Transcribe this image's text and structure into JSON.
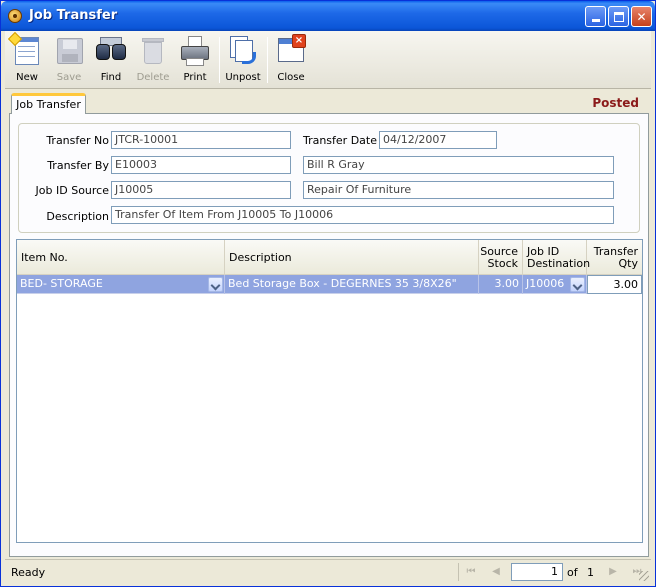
{
  "window": {
    "title": "Job Transfer"
  },
  "toolbar": {
    "new": "New",
    "save": "Save",
    "find": "Find",
    "delete": "Delete",
    "print": "Print",
    "unpost": "Unpost",
    "close": "Close"
  },
  "tab": {
    "label": "Job Transfer",
    "status": "Posted"
  },
  "form": {
    "transfer_no_label": "Transfer No",
    "transfer_no": "JTCR-10001",
    "transfer_date_label": "Transfer Date",
    "transfer_date": "04/12/2007",
    "transfer_by_label": "Transfer By",
    "transfer_by": "E10003",
    "transfer_by_name": "Bill R Gray",
    "job_id_source_label": "Job ID Source",
    "job_id_source": "J10005",
    "job_id_source_name": "Repair Of Furniture",
    "description_label": "Description",
    "description": "Transfer Of Item From J10005 To J10006"
  },
  "grid": {
    "headers": {
      "item_no": "Item No.",
      "description": "Description",
      "source_stock_1": "Source",
      "source_stock_2": "Stock",
      "job_dest_1": "Job ID",
      "job_dest_2": "Destination",
      "qty_1": "Transfer",
      "qty_2": "Qty"
    },
    "rows": [
      {
        "item_no": "BED- STORAGE",
        "description": "Bed Storage Box - DEGERNES 35 3/8X26\"",
        "source_stock": "3.00",
        "destination": "J10006",
        "qty": "3.00"
      }
    ]
  },
  "statusbar": {
    "text": "Ready",
    "page": "1",
    "of": "of",
    "total": "1"
  },
  "colors": {
    "title_bar": "#0B56D8",
    "selected_row": "#8FA4E0",
    "posted": "#8B1A1A",
    "tab_accent": "#FFC83C"
  }
}
